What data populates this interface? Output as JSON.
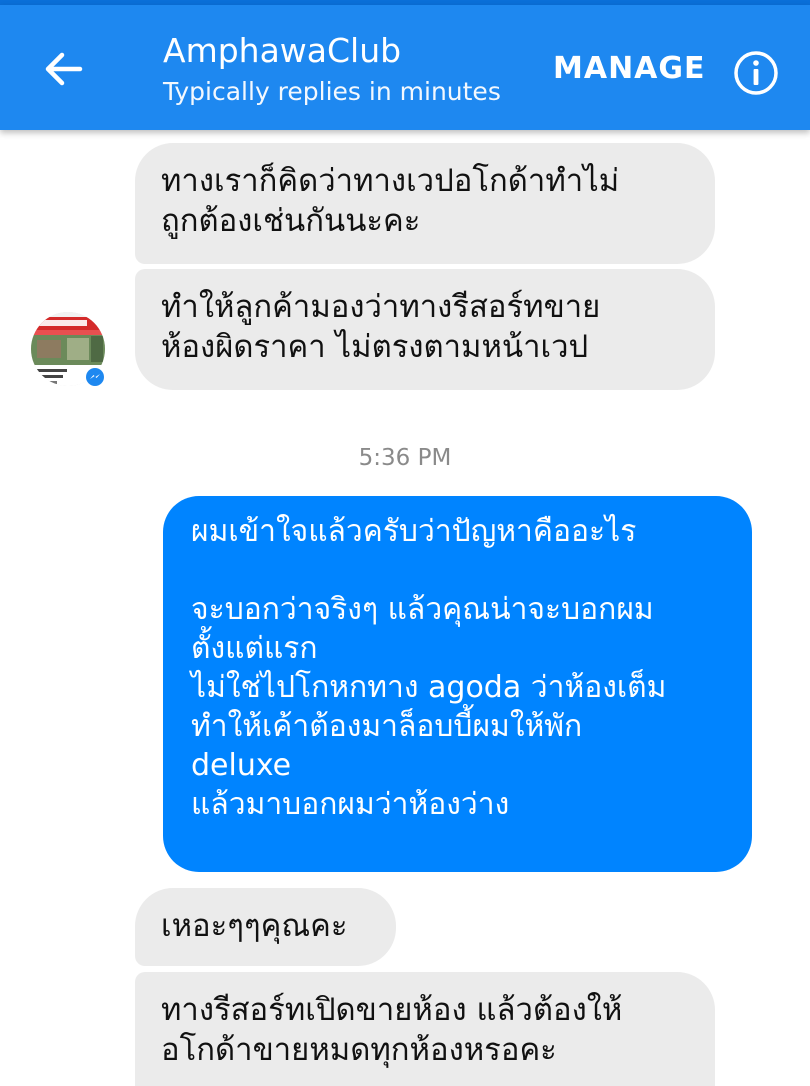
{
  "header": {
    "title": "AmphawaClub",
    "subtitle": "Typically replies in minutes",
    "manage_label": "MANAGE"
  },
  "icons": {
    "back": "arrow-left",
    "info": "info-circle",
    "messenger_badge": "messenger-bolt"
  },
  "colors": {
    "header_bg": "#1e88f0",
    "outgoing_bubble": "#0084ff",
    "incoming_bubble": "#ebebeb"
  },
  "messages": [
    {
      "direction": "incoming",
      "text": "ทางเราก็คิดว่าทางเวปอโกด้าทำไม่\nถูกต้องเช่นกันนะคะ"
    },
    {
      "direction": "incoming",
      "text": "ทำให้ลูกค้ามองว่าทางรีสอร์ทขาย\nห้องผิดราคา ไม่ตรงตามหน้าเวป"
    },
    {
      "direction": "outgoing",
      "text": "ผมเข้าใจแล้วครับว่าปัญหาคืออะไร\n\nจะบอกว่าจริงๆ แล้วคุณน่าจะบอกผม\nตั้งแต่แรก\nไม่ใช่ไปโกหกทาง agoda ว่าห้องเต็ม\nทำให้เค้าต้องมาล็อบบี้ผมให้พัก\ndeluxe\nแล้วมาบอกผมว่าห้องว่าง"
    },
    {
      "direction": "incoming",
      "text": "เหอะๆๆคุณคะ"
    },
    {
      "direction": "incoming",
      "text": "ทางรีสอร์ทเปิดขายห้อง แล้วต้องให้\nอโกด้าขายหมดทุกห้องหรอคะ"
    }
  ],
  "timestamp": "5:36 PM"
}
